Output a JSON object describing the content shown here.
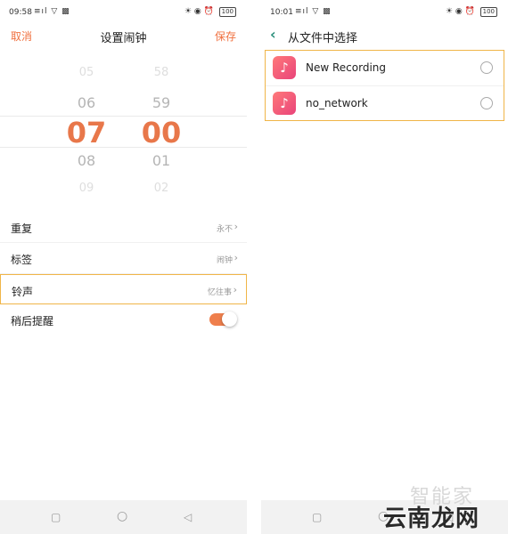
{
  "left": {
    "status": {
      "time": "09:58",
      "signal": "≡ıl ▽ ▩",
      "right_icons": "☀ ◉ ⏰",
      "battery": "100"
    },
    "header": {
      "cancel": "取消",
      "title": "设置闹钟",
      "save": "保存"
    },
    "picker": {
      "hours": [
        "05",
        "06",
        "07",
        "08",
        "09"
      ],
      "minutes": [
        "58",
        "59",
        "00",
        "01",
        "02"
      ]
    },
    "settings": [
      {
        "label": "重复",
        "value": "永不"
      },
      {
        "label": "标签",
        "value": "闹钟"
      },
      {
        "label": "铃声",
        "value": "忆往事"
      },
      {
        "label": "稍后提醒",
        "toggle": true
      }
    ]
  },
  "right": {
    "status": {
      "time": "10:01",
      "signal": "≡ıl ▽ ▩",
      "right_icons": "☀ ◉ ⏰",
      "battery": "100"
    },
    "header": {
      "title": "从文件中选择"
    },
    "files": [
      {
        "name": "New Recording",
        "icon": "music-note-icon"
      },
      {
        "name": "no_network",
        "icon": "music-note-icon"
      }
    ]
  },
  "navbar": {
    "square": "▢",
    "circle": "○",
    "triangle": "◁"
  },
  "watermark": {
    "top": "智能家",
    "bottom": "云南龙网"
  },
  "colors": {
    "accent": "#f0703f",
    "highlight_border": "#f0b548",
    "back": "#2a8f7a"
  }
}
